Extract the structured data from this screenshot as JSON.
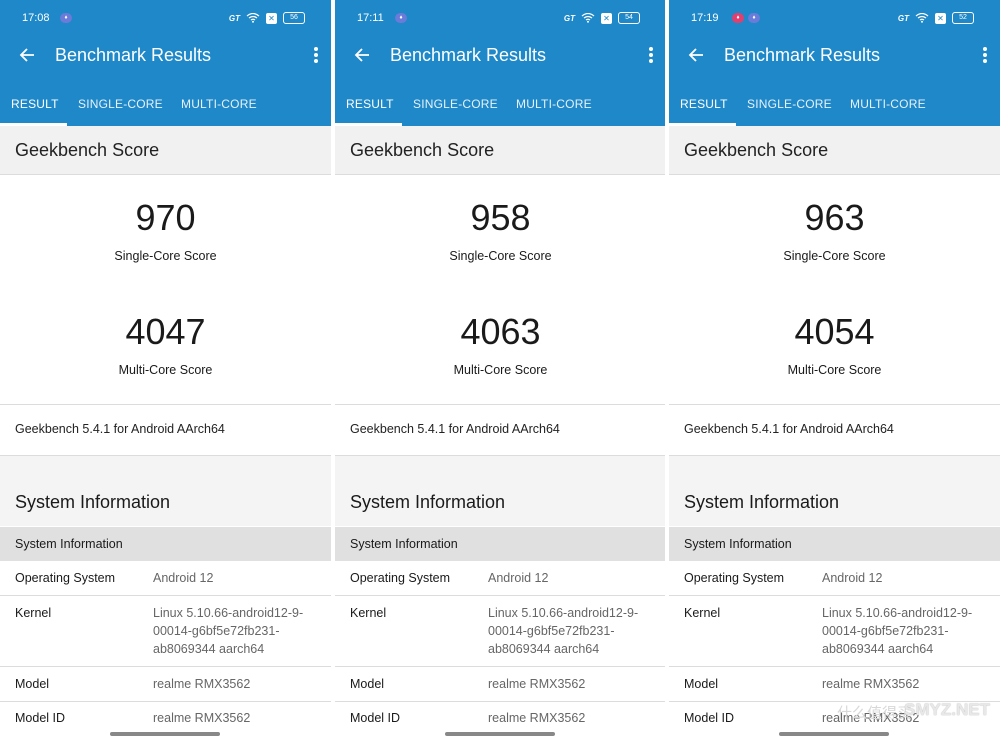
{
  "panels": [
    {
      "status": {
        "time": "17:08",
        "battery": "56"
      },
      "title": "Benchmark Results",
      "tabs": [
        "RESULT",
        "SINGLE-CORE",
        "MULTI-CORE"
      ],
      "section_title": "Geekbench Score",
      "single_score": "970",
      "single_label": "Single-Core Score",
      "multi_score": "4047",
      "multi_label": "Multi-Core Score",
      "version": "Geekbench 5.4.1 for Android AArch64",
      "sysinfo_title": "System Information",
      "sysinfo_subhead": "System Information",
      "rows": [
        {
          "key": "Operating System",
          "value": "Android 12"
        },
        {
          "key": "Kernel",
          "value": "Linux 5.10.66-android12-9-00014-g6bf5e72fb231-ab8069344 aarch64"
        },
        {
          "key": "Model",
          "value": "realme RMX3562"
        },
        {
          "key": "Model ID",
          "value": "realme RMX3562"
        }
      ]
    },
    {
      "status": {
        "time": "17:11",
        "battery": "54"
      },
      "title": "Benchmark Results",
      "tabs": [
        "RESULT",
        "SINGLE-CORE",
        "MULTI-CORE"
      ],
      "section_title": "Geekbench Score",
      "single_score": "958",
      "single_label": "Single-Core Score",
      "multi_score": "4063",
      "multi_label": "Multi-Core Score",
      "version": "Geekbench 5.4.1 for Android AArch64",
      "sysinfo_title": "System Information",
      "sysinfo_subhead": "System Information",
      "rows": [
        {
          "key": "Operating System",
          "value": "Android 12"
        },
        {
          "key": "Kernel",
          "value": "Linux 5.10.66-android12-9-00014-g6bf5e72fb231-ab8069344 aarch64"
        },
        {
          "key": "Model",
          "value": "realme RMX3562"
        },
        {
          "key": "Model ID",
          "value": "realme RMX3562"
        }
      ]
    },
    {
      "status": {
        "time": "17:19",
        "battery": "52"
      },
      "title": "Benchmark Results",
      "tabs": [
        "RESULT",
        "SINGLE-CORE",
        "MULTI-CORE"
      ],
      "section_title": "Geekbench Score",
      "single_score": "963",
      "single_label": "Single-Core Score",
      "multi_score": "4054",
      "multi_label": "Multi-Core Score",
      "version": "Geekbench 5.4.1 for Android AArch64",
      "sysinfo_title": "System Information",
      "sysinfo_subhead": "System Information",
      "rows": [
        {
          "key": "Operating System",
          "value": "Android 12"
        },
        {
          "key": "Kernel",
          "value": "Linux 5.10.66-android12-9-00014-g6bf5e72fb231-ab8069344 aarch64"
        },
        {
          "key": "Model",
          "value": "realme RMX3562"
        },
        {
          "key": "Model ID",
          "value": "realme RMX3562"
        }
      ]
    }
  ],
  "watermark": "SMYZ.NET",
  "watermark_cn": "什么值得买",
  "colors": {
    "appbar": "#1e88c8",
    "subhead": "#e0e0e0"
  }
}
